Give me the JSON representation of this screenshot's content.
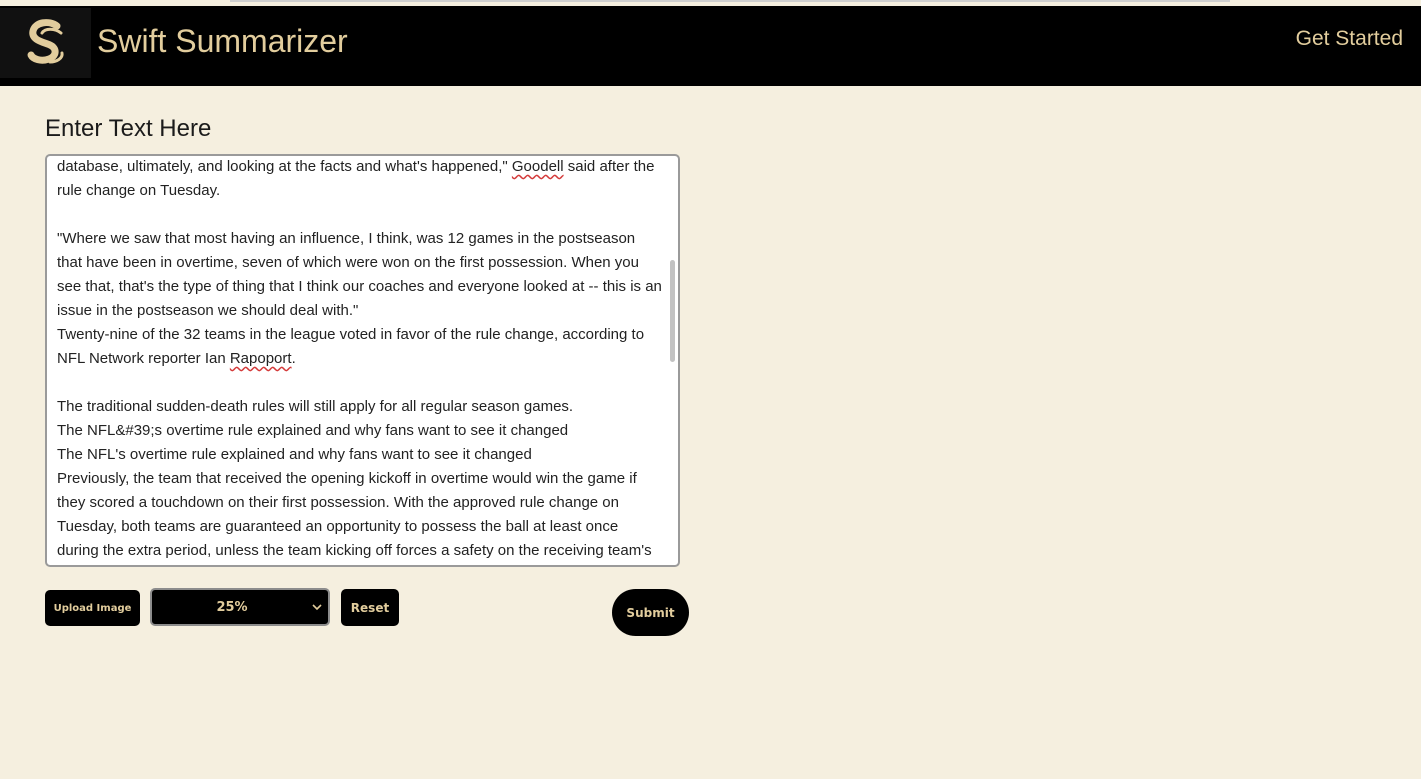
{
  "header": {
    "brand": "Swift Summarizer",
    "cta": "Get Started",
    "logo_icon": "stylized-s-logo-icon"
  },
  "main": {
    "title": "Enter Text Here",
    "textarea": {
      "lines": [
        "database, ultimately, and looking at the facts and what's happened,\" Goodell said after the rule change on Tuesday.",
        "",
        "\"Where we saw that most having an influence, I think, was 12 games in the postseason that have been in overtime, seven of which were won on the first possession. When you see that, that's the type of thing that I think our coaches and everyone looked at -- this is an issue in the postseason we should deal with.\"",
        "Twenty-nine of the 32 teams in the league voted in favor of the rule change, according to NFL Network reporter Ian Rapoport.",
        "",
        "The traditional sudden-death rules will still apply for all regular season games.",
        "The NFL&#39;s overtime rule explained and why fans want to see it changed",
        "The NFL's overtime rule explained and why fans want to see it changed",
        "Previously, the team that received the opening kickoff in overtime would win the game if they scored a touchdown on their first possession. With the approved rule change on Tuesday, both teams are guaranteed an opportunity to possess the ball at least once during the extra period, unless the team kicking off forces a safety on the receiving team's"
      ]
    }
  },
  "controls": {
    "upload_label": "Upload Image",
    "ratio_selected": "25%",
    "reset_label": "Reset",
    "submit_label": "Submit"
  },
  "colors": {
    "background": "#f5efdf",
    "header": "#000000",
    "accent": "#e2cd9d"
  }
}
